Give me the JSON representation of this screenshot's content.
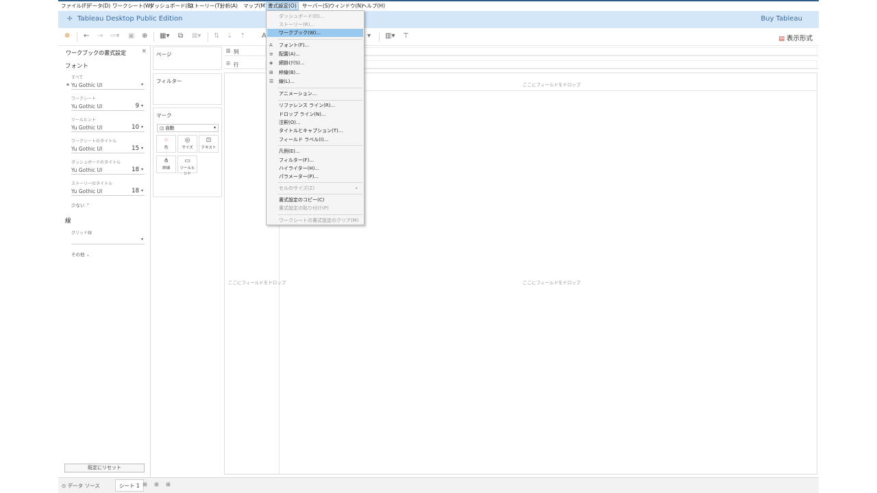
{
  "menubar": {
    "items": [
      "ファイル(F)",
      "データ(D)",
      "ワークシート(W)",
      "ダッシュボード(B)",
      "ストーリー(T)",
      "分析(A)",
      "マップ(M)",
      "書式設定(O)",
      "サーバー(S)",
      "ウィンドウ(N)",
      "ヘルプ(H)"
    ]
  },
  "titlebar": {
    "title": "Tableau Desktop Public Edition",
    "buy": "Buy Tableau"
  },
  "toolbar": {
    "view_format": "表示形式"
  },
  "format_panel": {
    "title": "ワークブックの書式設定",
    "font_section": "フォント",
    "groups": [
      {
        "label": "すべて",
        "font": "Yu Gothic UI",
        "size": ""
      },
      {
        "label": "ワークシート",
        "font": "Yu Gothic UI",
        "size": "9"
      },
      {
        "label": "ツールヒント",
        "font": "Yu Gothic UI",
        "size": "10"
      },
      {
        "label": "ワークシートのタイトル",
        "font": "Yu Gothic UI",
        "size": "15"
      },
      {
        "label": "ダッシュボードのタイトル",
        "font": "Yu Gothic UI",
        "size": "18"
      },
      {
        "label": "ストーリーのタイトル",
        "font": "Yu Gothic UI",
        "size": "18"
      }
    ],
    "less": "少ない",
    "lines_section": "線",
    "grid_label": "グリッド線",
    "other": "その他",
    "reset": "既定にリセット"
  },
  "cards": {
    "pages": "ページ",
    "filters": "フィルター",
    "marks": "マーク",
    "mark_type": "自動",
    "mark_buttons": [
      "色",
      "サイズ",
      "テキスト",
      "詳細",
      "ツールヒント"
    ]
  },
  "shelves": {
    "columns": "列",
    "rows": "行"
  },
  "canvas": {
    "drop_top": "ここにフィールドをドロップ",
    "drop_left": "ここにフィールドをドロップ",
    "drop_center": "ここにフィールドをドロップ"
  },
  "bottombar": {
    "data_source": "データ ソース",
    "sheet_tab": "シート 1"
  },
  "format_menu": {
    "items": [
      {
        "label": "ダッシュボード(D)...",
        "enabled": false
      },
      {
        "label": "ストーリー(R)...",
        "enabled": false
      },
      {
        "label": "ワークブック(W)...",
        "enabled": true,
        "highlighted": true
      },
      {
        "label": "フォント(F)...",
        "enabled": true,
        "icon": "A"
      },
      {
        "label": "配置(A)...",
        "enabled": true,
        "icon": "≡"
      },
      {
        "label": "網掛け(S)...",
        "enabled": true,
        "icon": "◈"
      },
      {
        "label": "枠線(B)...",
        "enabled": true,
        "icon": "⊞"
      },
      {
        "label": "線(L)...",
        "enabled": true,
        "icon": "☰"
      },
      {
        "label": "アニメーション...",
        "enabled": true
      },
      {
        "label": "リファレンス ライン(R)...",
        "enabled": true
      },
      {
        "label": "ドロップ ライン(N)...",
        "enabled": true
      },
      {
        "label": "注釈(O)...",
        "enabled": true
      },
      {
        "label": "タイトルとキャプション(T)...",
        "enabled": true
      },
      {
        "label": "フィールド ラベル(I)...",
        "enabled": true
      },
      {
        "label": "凡例(E)...",
        "enabled": true
      },
      {
        "label": "フィルター(F)...",
        "enabled": true
      },
      {
        "label": "ハイライター(H)...",
        "enabled": true
      },
      {
        "label": "パラメーター(P)...",
        "enabled": true
      },
      {
        "label": "セルのサイズ(Z)",
        "enabled": false
      },
      {
        "label": "書式設定のコピー(C)",
        "enabled": true
      },
      {
        "label": "書式設定の貼り付け(P)",
        "enabled": false
      },
      {
        "label": "ワークシートの書式設定のクリア(M)",
        "enabled": false
      }
    ]
  }
}
